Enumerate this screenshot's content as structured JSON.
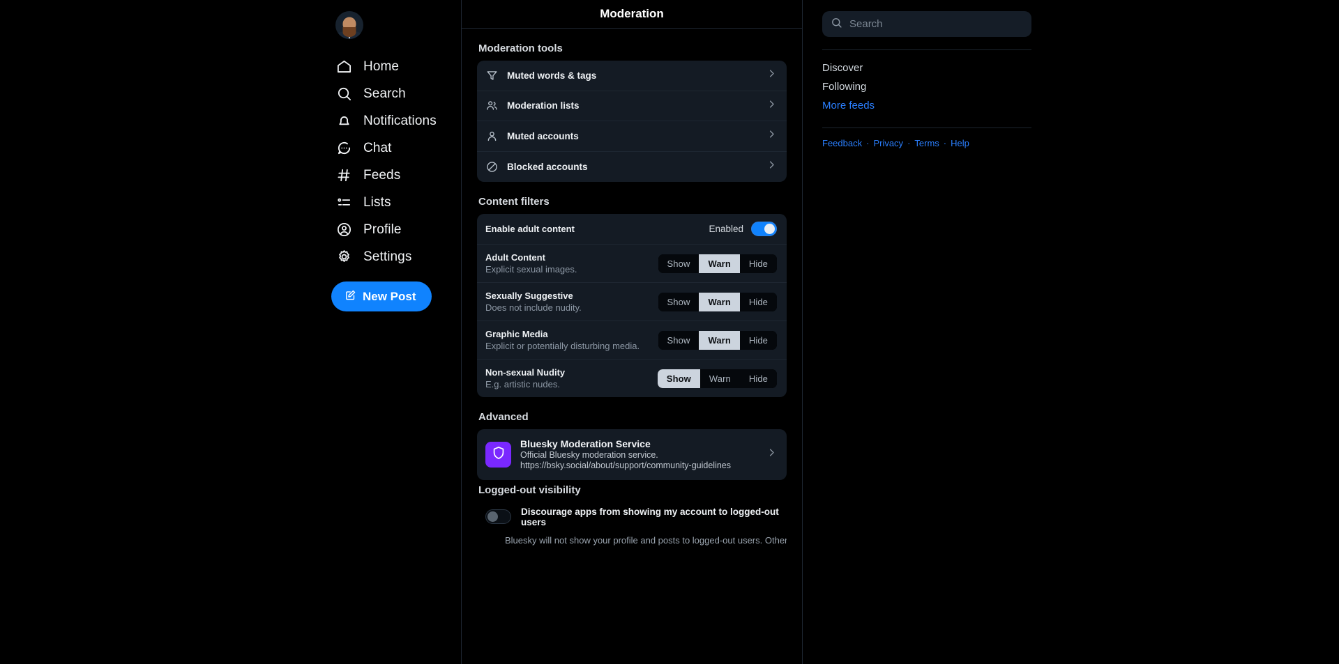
{
  "left_nav": {
    "avatar_alt": "user-avatar",
    "items": [
      {
        "icon": "home-icon",
        "label": "Home"
      },
      {
        "icon": "search-icon",
        "label": "Search"
      },
      {
        "icon": "bell-icon",
        "label": "Notifications"
      },
      {
        "icon": "chat-icon",
        "label": "Chat"
      },
      {
        "icon": "hash-icon",
        "label": "Feeds"
      },
      {
        "icon": "list-icon",
        "label": "Lists"
      },
      {
        "icon": "profile-icon",
        "label": "Profile"
      },
      {
        "icon": "gear-icon",
        "label": "Settings"
      }
    ],
    "new_post_label": "New Post"
  },
  "header": {
    "title": "Moderation",
    "back_icon": "chevron-left-icon"
  },
  "moderation_tools": {
    "section_title": "Moderation tools",
    "items": [
      {
        "icon": "filter-icon",
        "label": "Muted words & tags"
      },
      {
        "icon": "people-icon",
        "label": "Moderation lists"
      },
      {
        "icon": "person-icon",
        "label": "Muted accounts"
      },
      {
        "icon": "block-icon",
        "label": "Blocked accounts"
      }
    ]
  },
  "content_filters": {
    "section_title": "Content filters",
    "adult_toggle": {
      "label": "Enable adult content",
      "state_label": "Enabled",
      "enabled": true
    },
    "options": [
      "Show",
      "Warn",
      "Hide"
    ],
    "rows": [
      {
        "title": "Adult Content",
        "desc": "Explicit sexual images.",
        "selected": "Warn"
      },
      {
        "title": "Sexually Suggestive",
        "desc": "Does not include nudity.",
        "selected": "Warn"
      },
      {
        "title": "Graphic Media",
        "desc": "Explicit or potentially disturbing media.",
        "selected": "Warn"
      },
      {
        "title": "Non-sexual Nudity",
        "desc": "E.g. artistic nudes.",
        "selected": "Show"
      }
    ]
  },
  "advanced": {
    "section_title": "Advanced",
    "labeler": {
      "icon": "shield-icon",
      "name": "Bluesky Moderation Service",
      "desc": "Official Bluesky moderation service.",
      "url": "https://bsky.social/about/support/community-guidelines",
      "logo_color": "#7a28ff"
    }
  },
  "logged_out_visibility": {
    "section_title": "Logged-out visibility",
    "toggle_label": "Discourage apps from showing my account to logged-out users",
    "enabled": false,
    "note": "Bluesky will not show your profile and posts to logged-out users. Other apps may"
  },
  "right_sidebar": {
    "search_placeholder": "Search",
    "search_value": "",
    "search_icon": "search-icon",
    "feeds": [
      {
        "label": "Discover",
        "accent": false
      },
      {
        "label": "Following",
        "accent": false
      },
      {
        "label": "More feeds",
        "accent": true
      }
    ],
    "footer_links": [
      "Feedback",
      "Privacy",
      "Terms",
      "Help"
    ],
    "footer_separator": "·"
  },
  "colors": {
    "accent": "#1083fe",
    "link": "#2a7fff",
    "card": "#141b24",
    "background": "#000000",
    "selected_segment": "#ccd4de"
  }
}
